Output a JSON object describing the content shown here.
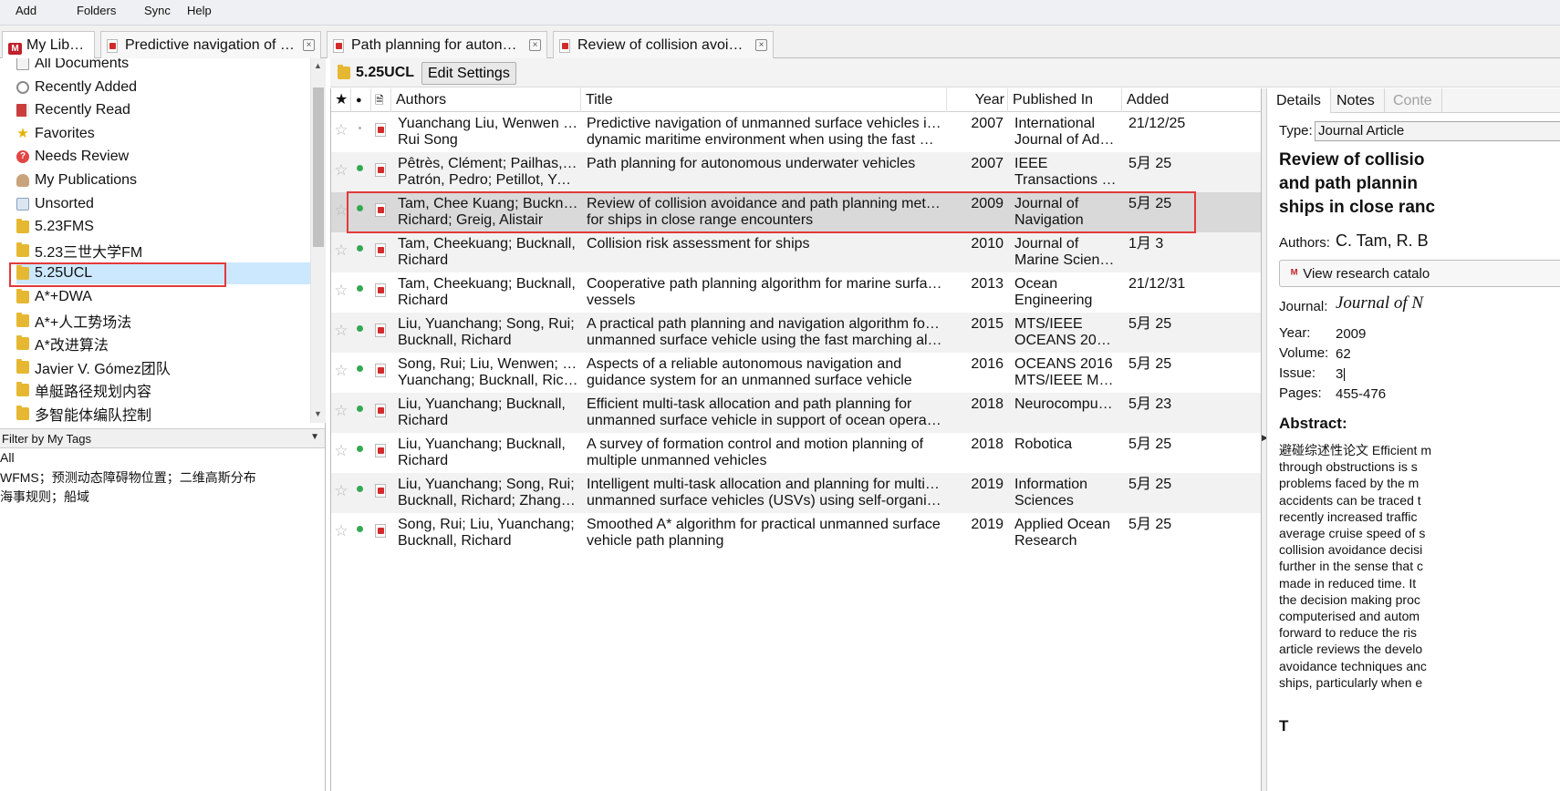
{
  "menu": {
    "add": "Add",
    "folders": "Folders",
    "sync": "Sync",
    "help": "Help"
  },
  "tabs": [
    {
      "label": "My Library"
    },
    {
      "label": "Predictive navigation of un..."
    },
    {
      "label": "Path planning for autonom..."
    },
    {
      "label": "Review of collision avoidan..."
    }
  ],
  "sidebar": {
    "items": [
      {
        "label": "All Documents",
        "icon": "all-documents-icon"
      },
      {
        "label": "Recently Added",
        "icon": "clock-icon"
      },
      {
        "label": "Recently Read",
        "icon": "book-icon"
      },
      {
        "label": "Favorites",
        "icon": "star-icon"
      },
      {
        "label": "Needs Review",
        "icon": "needs-review-icon"
      },
      {
        "label": "My Publications",
        "icon": "person-icon"
      },
      {
        "label": "Unsorted",
        "icon": "unsorted-icon"
      },
      {
        "label": "5.23FMS",
        "icon": "folder-icon"
      },
      {
        "label": "5.23三世大学FM",
        "icon": "folder-icon"
      },
      {
        "label": "5.25UCL",
        "icon": "folder-icon",
        "selected": true
      },
      {
        "label": "A*+DWA",
        "icon": "folder-icon"
      },
      {
        "label": "A*+人工势场法",
        "icon": "folder-icon"
      },
      {
        "label": "A*改进算法",
        "icon": "folder-icon"
      },
      {
        "label": "Javier V. Gómez团队",
        "icon": "folder-icon"
      },
      {
        "label": "单艇路径规划内容",
        "icon": "folder-icon"
      },
      {
        "label": "多智能体编队控制",
        "icon": "folder-icon"
      }
    ]
  },
  "tag_filter": {
    "label": "Filter by My Tags",
    "tags": [
      "All",
      "WFMS；预测动态障碍物位置；二维高斯分布",
      "海事规则；船域"
    ]
  },
  "toolbar": {
    "folder_name": "5.25UCL",
    "edit_settings": "Edit Settings"
  },
  "table": {
    "headers": {
      "star": "★",
      "read": "●",
      "file": "🗎",
      "authors": "Authors",
      "title": "Title",
      "year": "Year",
      "published_in": "Published In",
      "added": "Added"
    },
    "rows": [
      {
        "authors": [
          "Yuanchang Liu, Wenwen Liu,",
          "Rui Song"
        ],
        "title": [
          "Predictive navigation of unmanned surface vehicles in a",
          "dynamic maritime environment when using the fast mar..."
        ],
        "year": "2007",
        "published_in": [
          "International",
          "Journal of Ada..."
        ],
        "added": "21/12/25",
        "unread": false
      },
      {
        "authors": [
          "Pêtrès, Clément; Pailhas, Yan;",
          "Patrón, Pedro; Petillot, Yva..."
        ],
        "title": [
          "Path planning for autonomous underwater vehicles",
          ""
        ],
        "year": "2007",
        "published_in": [
          "IEEE",
          "Transactions o..."
        ],
        "added": "5月 25",
        "unread": true
      },
      {
        "authors": [
          "Tam, Chee Kuang; Bucknall,",
          "Richard; Greig, Alistair"
        ],
        "title": [
          "Review of collision avoidance and path planning methods",
          "for ships in close range encounters"
        ],
        "year": "2009",
        "published_in": [
          "Journal of",
          "Navigation"
        ],
        "added": "5月 25",
        "unread": true,
        "selected": true
      },
      {
        "authors": [
          "Tam, Cheekuang; Bucknall,",
          "Richard"
        ],
        "title": [
          "Collision risk assessment for ships",
          ""
        ],
        "year": "2010",
        "published_in": [
          "Journal of",
          "Marine Scienc..."
        ],
        "added": "1月 3",
        "unread": true
      },
      {
        "authors": [
          "Tam, Cheekuang; Bucknall,",
          "Richard"
        ],
        "title": [
          "Cooperative path planning algorithm for marine surface",
          "vessels"
        ],
        "year": "2013",
        "published_in": [
          "Ocean",
          "Engineering"
        ],
        "added": "21/12/31",
        "unread": true
      },
      {
        "authors": [
          "Liu, Yuanchang; Song, Rui;",
          "Bucknall, Richard"
        ],
        "title": [
          "A practical path planning and navigation algorithm for an",
          "unmanned surface vehicle using the fast marching algori..."
        ],
        "year": "2015",
        "published_in": [
          "MTS/IEEE",
          "OCEANS 2015 ..."
        ],
        "added": "5月 25",
        "unread": true
      },
      {
        "authors": [
          "Song, Rui; Liu, Wenwen; Liu,",
          "Yuanchang; Bucknall, Richard"
        ],
        "title": [
          "Aspects of a reliable autonomous navigation and",
          "guidance system for an unmanned surface vehicle"
        ],
        "year": "2016",
        "published_in": [
          "OCEANS 2016",
          "MTS/IEEE Mon..."
        ],
        "added": "5月 25",
        "unread": true
      },
      {
        "authors": [
          "Liu, Yuanchang; Bucknall,",
          "Richard"
        ],
        "title": [
          "Efficient multi-task allocation and path planning for",
          "unmanned surface vehicle in support of ocean operations"
        ],
        "year": "2018",
        "published_in": [
          "Neurocomputi...",
          ""
        ],
        "added": "5月 23",
        "unread": true
      },
      {
        "authors": [
          "Liu, Yuanchang; Bucknall,",
          "Richard"
        ],
        "title": [
          "A survey of formation control and motion planning of",
          "multiple unmanned vehicles"
        ],
        "year": "2018",
        "published_in": [
          "Robotica",
          ""
        ],
        "added": "5月 25",
        "unread": true
      },
      {
        "authors": [
          "Liu, Yuanchang; Song, Rui;",
          "Bucknall, Richard; Zhang, Xi..."
        ],
        "title": [
          "Intelligent multi-task allocation and planning for multiple",
          "unmanned surface vehicles (USVs) using self-organising ..."
        ],
        "year": "2019",
        "published_in": [
          "Information",
          "Sciences"
        ],
        "added": "5月 25",
        "unread": true
      },
      {
        "authors": [
          "Song, Rui; Liu, Yuanchang;",
          "Bucknall, Richard"
        ],
        "title": [
          "Smoothed A* algorithm for practical unmanned surface",
          "vehicle path planning"
        ],
        "year": "2019",
        "published_in": [
          "Applied Ocean",
          "Research"
        ],
        "added": "5月 25",
        "unread": true
      }
    ]
  },
  "details": {
    "tabs": {
      "details": "Details",
      "notes": "Notes",
      "contents": "Conte"
    },
    "type_label": "Type:",
    "type_value": "Journal Article",
    "title_lines": [
      "Review of collisio",
      "and path plannin",
      "ships in close ranc"
    ],
    "authors_label": "Authors:",
    "authors_value": "C. Tam, R. B",
    "view_catalog": "View research catalo",
    "journal_label": "Journal:",
    "journal_value": "Journal of N",
    "year_label": "Year:",
    "year_value": "2009",
    "volume_label": "Volume:",
    "volume_value": "62",
    "issue_label": "Issue:",
    "issue_value": "3",
    "pages_label": "Pages:",
    "pages_value": "455-476",
    "abstract_label": "Abstract:",
    "abstract_lines": [
      "避碰综述性论文 Efficient m",
      "through obstructions is s",
      "problems faced by the m",
      "accidents can be traced t",
      "recently increased traffic",
      "average cruise speed of s",
      "collision avoidance decisi",
      "further in the sense that c",
      "made in reduced time. It",
      "the decision making proc",
      "computerised and autom",
      "forward to reduce the ris",
      "article reviews the develo",
      "avoidance techniques anc",
      "ships, particularly when e"
    ],
    "tags_label_partial": "T"
  }
}
